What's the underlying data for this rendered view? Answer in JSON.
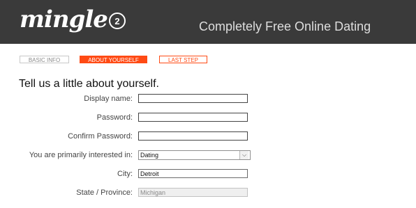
{
  "header": {
    "logo_text": "mingle",
    "logo_badge": "2",
    "tagline": "Completely Free Online Dating",
    "background_color": "#3a3a3a"
  },
  "steps": [
    {
      "label": "BASIC INFO",
      "state": "done"
    },
    {
      "label": "ABOUT YOURSELF",
      "state": "active"
    },
    {
      "label": "LAST STEP",
      "state": "upcoming"
    }
  ],
  "accent_color": "#ff4a14",
  "form": {
    "heading": "Tell us a little about yourself.",
    "fields": {
      "display_name": {
        "label": "Display name:",
        "value": ""
      },
      "password": {
        "label": "Password:",
        "value": ""
      },
      "confirm_password": {
        "label": "Confirm Password:",
        "value": ""
      },
      "interest": {
        "label": "You are primarily interested in:",
        "value": "Dating",
        "icon": "chevron-down-icon"
      },
      "city": {
        "label": "City:",
        "value": "Detroit"
      },
      "state": {
        "label": "State / Province:",
        "value": "Michigan",
        "disabled": true
      }
    }
  }
}
